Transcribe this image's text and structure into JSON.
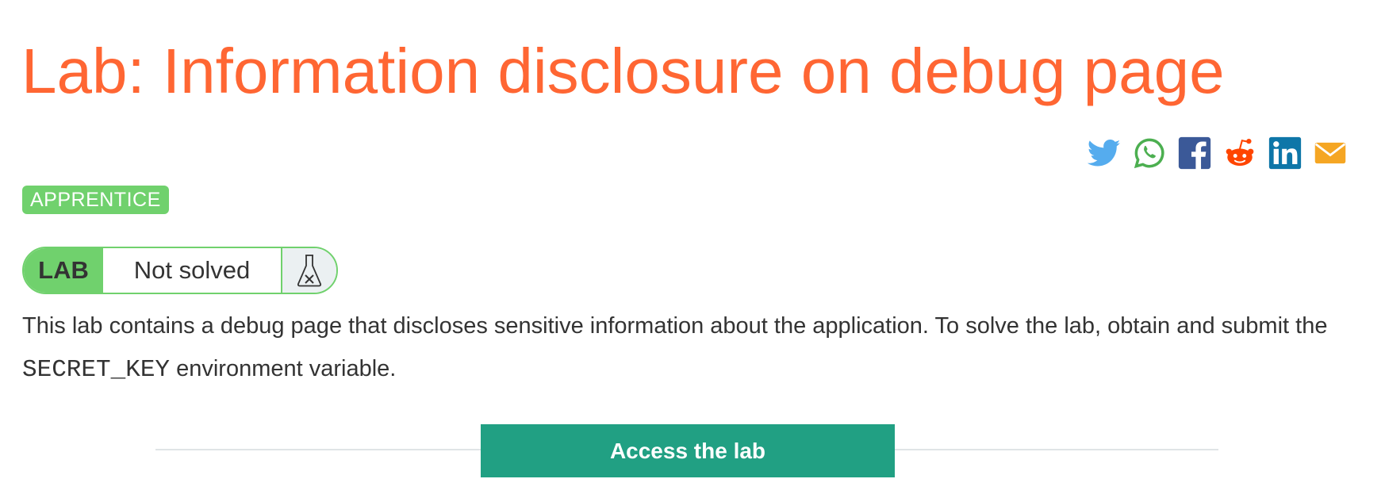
{
  "title": "Lab: Information disclosure on debug page",
  "share": {
    "icons": [
      "twitter-icon",
      "whatsapp-icon",
      "facebook-icon",
      "reddit-icon",
      "linkedin-icon",
      "email-icon"
    ],
    "colors": {
      "twitter": "#55acee",
      "whatsapp": "#4caf50",
      "facebook": "#3b5998",
      "reddit": "#ff4500",
      "linkedin": "#0e76a8",
      "email": "#f5a623"
    }
  },
  "level": "APPRENTICE",
  "lab_status": {
    "tag": "LAB",
    "state": "Not solved",
    "icon": "flask-not-solved-icon"
  },
  "description": {
    "before": "This lab contains a debug page that discloses sensitive information about the application. To solve the lab, obtain and submit the ",
    "code": "SECRET_KEY",
    "after": " environment variable."
  },
  "access_button": "Access the lab",
  "colors": {
    "title": "#ff6633",
    "badge": "#70d16d",
    "button": "#21a083"
  }
}
